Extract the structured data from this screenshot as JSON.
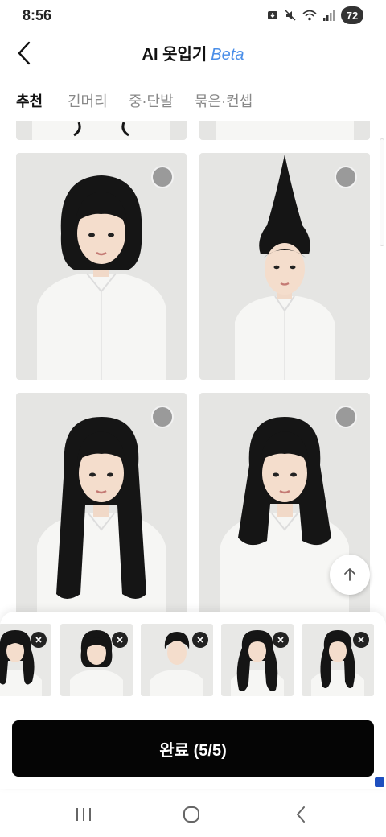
{
  "status_bar": {
    "time": "8:56",
    "battery": "72"
  },
  "header": {
    "title": "AI 옷입기",
    "beta": "Beta"
  },
  "tabs": [
    {
      "label": "추천",
      "active": true
    },
    {
      "label": "긴머리",
      "active": false
    },
    {
      "label": "중·단발",
      "active": false
    },
    {
      "label": "묶은·컨셉",
      "active": false
    }
  ],
  "grid": {
    "styles": [
      "bob",
      "cone",
      "long-straight",
      "medium-bangs"
    ]
  },
  "selected_thumbnails": [
    "wavy-long",
    "bob-bangs",
    "tied",
    "long-wavy",
    "long-wavy-2"
  ],
  "done_button": {
    "label": "완료 (5/5)"
  },
  "colors": {
    "accent": "#4a8ee8",
    "button_bg": "#050505",
    "hair": "#151515",
    "shirt": "#f6f6f4",
    "card_bg": "#e5e5e3"
  }
}
